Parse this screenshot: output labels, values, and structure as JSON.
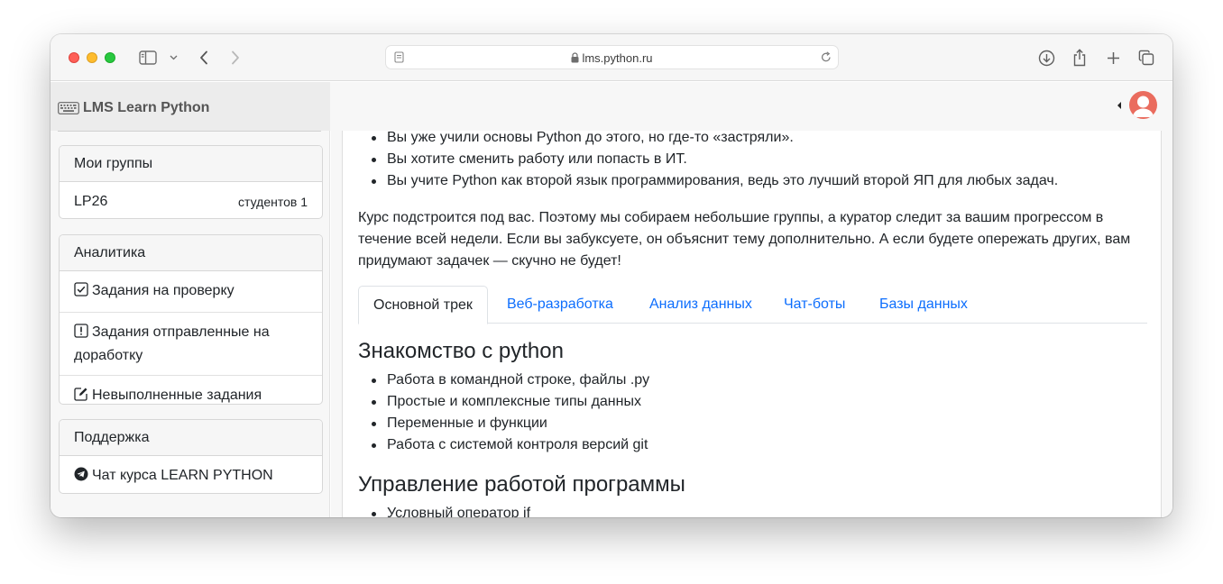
{
  "browser": {
    "url": "lms.python.ru"
  },
  "site": {
    "brand": "LMS Learn Python"
  },
  "sidebar": {
    "groups": {
      "header": "Мои группы",
      "items": [
        {
          "label": "LP26",
          "badge": "студентов 1"
        }
      ]
    },
    "analytics": {
      "header": "Аналитика",
      "items": [
        {
          "label": "Задания на проверку",
          "icon": "check-square-icon"
        },
        {
          "label": "Задания отправленные на доработку",
          "icon": "exclamation-square-icon"
        },
        {
          "label": "Невыполненные задания",
          "icon": "pencil-square-icon"
        }
      ]
    },
    "support": {
      "header": "Поддержка",
      "items": [
        {
          "label": "Чат курса LEARN PYTHON",
          "icon": "telegram-icon"
        }
      ]
    }
  },
  "main": {
    "intro_bullets": [
      "Вы уже учили основы Python до этого, но где-то «застряли».",
      "Вы хотите сменить работу или попасть в ИТ.",
      "Вы учите Python как второй язык программирования, ведь это лучший второй ЯП для любых задач."
    ],
    "paragraph": "Курс подстроится под вас. Поэтому мы собираем небольшие группы, а куратор следит за вашим прогрессом в течение всей недели. Если вы забуксуете, он объяснит тему дополнительно. А если будете опережать других, вам придумают задачек — скучно не будет!",
    "tabs": [
      "Основной трек",
      "Веб-разработка",
      "Анализ данных",
      "Чат-боты",
      "Базы данных"
    ],
    "active_tab": "Основной трек",
    "sections": [
      {
        "title": "Знакомство с python",
        "items": [
          "Работа в командной строке, файлы .py",
          "Простые и комплексные типы данных",
          "Переменные и функции",
          "Работа с системой контроля версий git"
        ]
      },
      {
        "title": "Управление работой программы",
        "items": [
          "Условный оператор if"
        ]
      }
    ]
  },
  "colors": {
    "link": "#0d6efd",
    "text": "#212529",
    "avatar": "#ea6c5e"
  }
}
